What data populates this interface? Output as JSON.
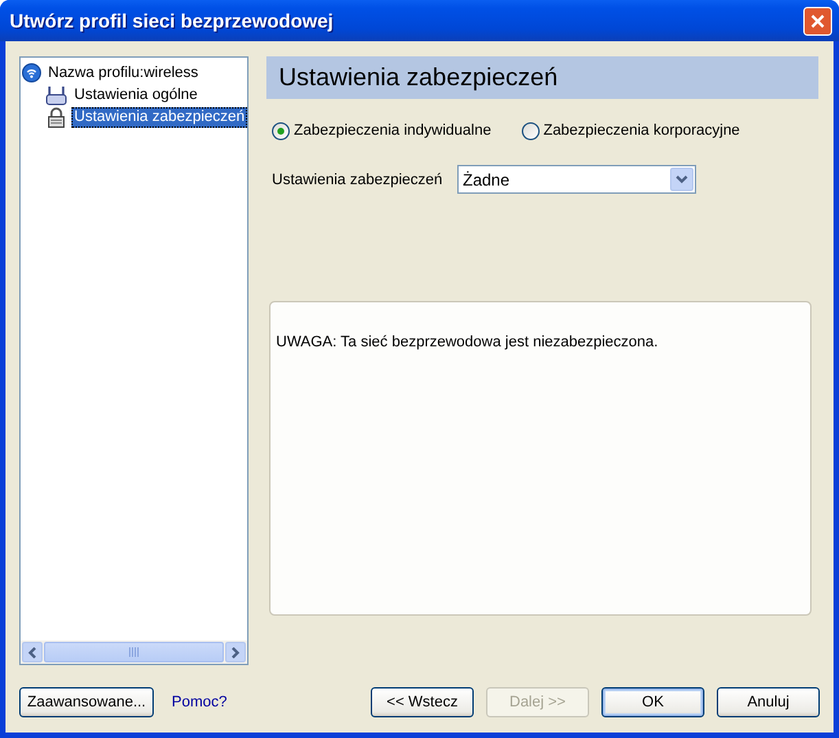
{
  "window": {
    "title": "Utwórz profil sieci bezprzewodowej"
  },
  "tree": {
    "label": "Nazwa profilu:wireless",
    "selected": false,
    "children": [
      {
        "label": "Ustawienia ogólne",
        "kind": "router",
        "selected": false
      },
      {
        "label": "Ustawienia zabezpieczeń",
        "kind": "lock",
        "selected": true
      }
    ]
  },
  "panel": {
    "heading": "Ustawienia zabezpieczeń",
    "radios": [
      {
        "label": "Zabezpieczenia indywidualne",
        "selected": true
      },
      {
        "label": "Zabezpieczenia korporacyjne",
        "selected": false
      }
    ],
    "security_field": {
      "label": "Ustawienia zabezpieczeń",
      "value": "Żadne"
    },
    "notice": "UWAGA: Ta sieć bezprzewodowa jest niezabezpieczona."
  },
  "left_controls": [
    {
      "label": "Zaawansowane...",
      "kind": "button"
    },
    {
      "label": "Pomoc?",
      "kind": "link"
    }
  ],
  "buttons": [
    {
      "label": "<< Wstecz",
      "disabled": false,
      "default": false
    },
    {
      "label": "Dalej >>",
      "disabled": true,
      "default": false
    },
    {
      "label": "OK",
      "disabled": false,
      "default": true
    },
    {
      "label": "Anuluj",
      "disabled": false,
      "default": false
    }
  ]
}
